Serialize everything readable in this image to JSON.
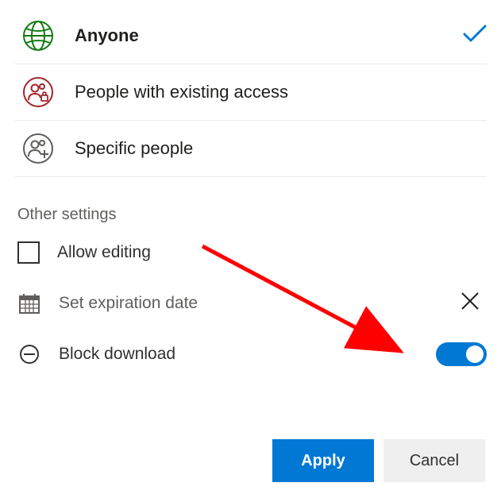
{
  "options": {
    "anyone": {
      "label": "Anyone",
      "selected": true
    },
    "existing": {
      "label": "People with existing access",
      "selected": false
    },
    "specific": {
      "label": "Specific people",
      "selected": false
    }
  },
  "section_title": "Other settings",
  "settings": {
    "allow_editing": {
      "label": "Allow editing",
      "checked": false
    },
    "set_expiration": {
      "label": "Set expiration date"
    },
    "block_download": {
      "label": "Block download",
      "enabled": true
    }
  },
  "buttons": {
    "apply": "Apply",
    "cancel": "Cancel"
  },
  "colors": {
    "accent": "#0078d4",
    "green": "#107c10",
    "red": "#a4262c",
    "grey": "#605e5c"
  }
}
